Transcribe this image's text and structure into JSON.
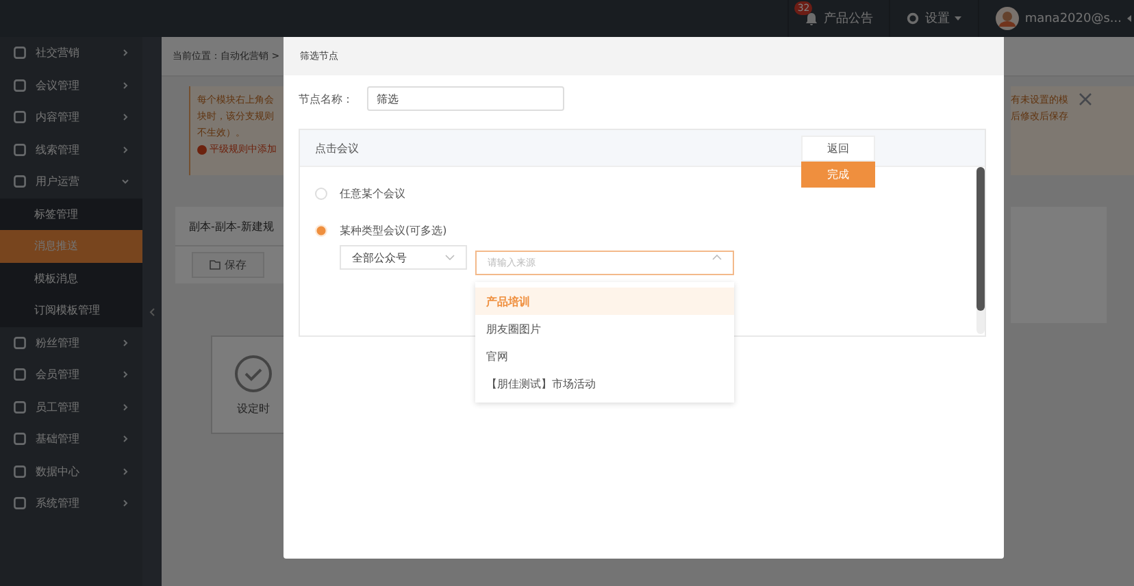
{
  "top_bar": {
    "notifications": {
      "badge": "32",
      "label": "产品公告"
    },
    "settings": {
      "label": "设置"
    },
    "user": {
      "name": "mana2020@s..."
    }
  },
  "sidebar": {
    "items": [
      {
        "label": "社交营销",
        "expanded": false
      },
      {
        "label": "会议管理",
        "expanded": false
      },
      {
        "label": "内容管理",
        "expanded": false
      },
      {
        "label": "线索管理",
        "expanded": false
      },
      {
        "label": "用户运营",
        "expanded": true,
        "children": [
          {
            "label": "标签管理",
            "selected": false
          },
          {
            "label": "消息推送",
            "selected": true
          },
          {
            "label": "模板消息",
            "selected": false
          },
          {
            "label": "订阅模板管理",
            "selected": false
          }
        ]
      },
      {
        "label": "粉丝管理",
        "expanded": false
      },
      {
        "label": "会员管理",
        "expanded": false
      },
      {
        "label": "员工管理",
        "expanded": false
      },
      {
        "label": "基础管理",
        "expanded": false
      },
      {
        "label": "数据中心",
        "expanded": false
      },
      {
        "label": "系统管理",
        "expanded": false
      }
    ]
  },
  "page": {
    "breadcrumb": "当前位置：自动化营销 >",
    "notice_left": [
      "每个模块右上角会",
      "块时，该分支规则",
      "不生效）。"
    ],
    "warning": "平级规则中添加",
    "notice_right": [
      "有未设置的模",
      "后修改后保存"
    ],
    "rule_title": "副本-副本-新建规",
    "save_button": "保存",
    "node_card": "设定时"
  },
  "modal": {
    "title": "筛选节点",
    "node_name": {
      "label": "节点名称：",
      "value": "筛选"
    },
    "panel": {
      "title": "点击会议",
      "buttons": [
        {
          "label": "返回",
          "kind": "secondary"
        },
        {
          "label": "完成",
          "kind": "primary"
        }
      ],
      "options": [
        {
          "label": "任意某个会议",
          "selected": false
        },
        {
          "label": "某种类型会议(可多选)",
          "selected": true
        }
      ],
      "account_select": {
        "value": "全部公众号"
      },
      "source_select": {
        "placeholder": "请输入来源",
        "open": true
      },
      "dropdown": [
        {
          "label": "产品培训",
          "selected": true
        },
        {
          "label": "朋友圈图片",
          "selected": false
        },
        {
          "label": "官网",
          "selected": false
        },
        {
          "label": "【朋佳测试】市场活动",
          "selected": false
        }
      ]
    }
  }
}
